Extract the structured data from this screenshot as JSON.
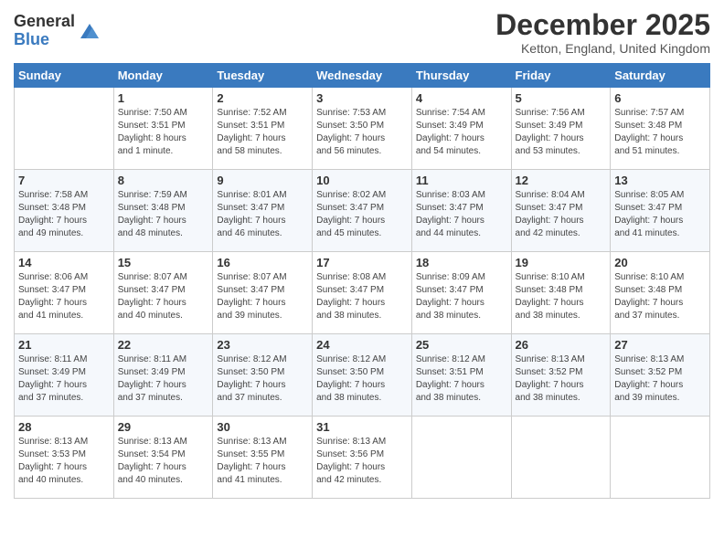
{
  "header": {
    "logo_general": "General",
    "logo_blue": "Blue",
    "month_title": "December 2025",
    "location": "Ketton, England, United Kingdom"
  },
  "days_of_week": [
    "Sunday",
    "Monday",
    "Tuesday",
    "Wednesday",
    "Thursday",
    "Friday",
    "Saturday"
  ],
  "weeks": [
    [
      {
        "day": "",
        "content": ""
      },
      {
        "day": "1",
        "content": "Sunrise: 7:50 AM\nSunset: 3:51 PM\nDaylight: 8 hours\nand 1 minute."
      },
      {
        "day": "2",
        "content": "Sunrise: 7:52 AM\nSunset: 3:51 PM\nDaylight: 7 hours\nand 58 minutes."
      },
      {
        "day": "3",
        "content": "Sunrise: 7:53 AM\nSunset: 3:50 PM\nDaylight: 7 hours\nand 56 minutes."
      },
      {
        "day": "4",
        "content": "Sunrise: 7:54 AM\nSunset: 3:49 PM\nDaylight: 7 hours\nand 54 minutes."
      },
      {
        "day": "5",
        "content": "Sunrise: 7:56 AM\nSunset: 3:49 PM\nDaylight: 7 hours\nand 53 minutes."
      },
      {
        "day": "6",
        "content": "Sunrise: 7:57 AM\nSunset: 3:48 PM\nDaylight: 7 hours\nand 51 minutes."
      }
    ],
    [
      {
        "day": "7",
        "content": "Sunrise: 7:58 AM\nSunset: 3:48 PM\nDaylight: 7 hours\nand 49 minutes."
      },
      {
        "day": "8",
        "content": "Sunrise: 7:59 AM\nSunset: 3:48 PM\nDaylight: 7 hours\nand 48 minutes."
      },
      {
        "day": "9",
        "content": "Sunrise: 8:01 AM\nSunset: 3:47 PM\nDaylight: 7 hours\nand 46 minutes."
      },
      {
        "day": "10",
        "content": "Sunrise: 8:02 AM\nSunset: 3:47 PM\nDaylight: 7 hours\nand 45 minutes."
      },
      {
        "day": "11",
        "content": "Sunrise: 8:03 AM\nSunset: 3:47 PM\nDaylight: 7 hours\nand 44 minutes."
      },
      {
        "day": "12",
        "content": "Sunrise: 8:04 AM\nSunset: 3:47 PM\nDaylight: 7 hours\nand 42 minutes."
      },
      {
        "day": "13",
        "content": "Sunrise: 8:05 AM\nSunset: 3:47 PM\nDaylight: 7 hours\nand 41 minutes."
      }
    ],
    [
      {
        "day": "14",
        "content": "Sunrise: 8:06 AM\nSunset: 3:47 PM\nDaylight: 7 hours\nand 41 minutes."
      },
      {
        "day": "15",
        "content": "Sunrise: 8:07 AM\nSunset: 3:47 PM\nDaylight: 7 hours\nand 40 minutes."
      },
      {
        "day": "16",
        "content": "Sunrise: 8:07 AM\nSunset: 3:47 PM\nDaylight: 7 hours\nand 39 minutes."
      },
      {
        "day": "17",
        "content": "Sunrise: 8:08 AM\nSunset: 3:47 PM\nDaylight: 7 hours\nand 38 minutes."
      },
      {
        "day": "18",
        "content": "Sunrise: 8:09 AM\nSunset: 3:47 PM\nDaylight: 7 hours\nand 38 minutes."
      },
      {
        "day": "19",
        "content": "Sunrise: 8:10 AM\nSunset: 3:48 PM\nDaylight: 7 hours\nand 38 minutes."
      },
      {
        "day": "20",
        "content": "Sunrise: 8:10 AM\nSunset: 3:48 PM\nDaylight: 7 hours\nand 37 minutes."
      }
    ],
    [
      {
        "day": "21",
        "content": "Sunrise: 8:11 AM\nSunset: 3:49 PM\nDaylight: 7 hours\nand 37 minutes."
      },
      {
        "day": "22",
        "content": "Sunrise: 8:11 AM\nSunset: 3:49 PM\nDaylight: 7 hours\nand 37 minutes."
      },
      {
        "day": "23",
        "content": "Sunrise: 8:12 AM\nSunset: 3:50 PM\nDaylight: 7 hours\nand 37 minutes."
      },
      {
        "day": "24",
        "content": "Sunrise: 8:12 AM\nSunset: 3:50 PM\nDaylight: 7 hours\nand 38 minutes."
      },
      {
        "day": "25",
        "content": "Sunrise: 8:12 AM\nSunset: 3:51 PM\nDaylight: 7 hours\nand 38 minutes."
      },
      {
        "day": "26",
        "content": "Sunrise: 8:13 AM\nSunset: 3:52 PM\nDaylight: 7 hours\nand 38 minutes."
      },
      {
        "day": "27",
        "content": "Sunrise: 8:13 AM\nSunset: 3:52 PM\nDaylight: 7 hours\nand 39 minutes."
      }
    ],
    [
      {
        "day": "28",
        "content": "Sunrise: 8:13 AM\nSunset: 3:53 PM\nDaylight: 7 hours\nand 40 minutes."
      },
      {
        "day": "29",
        "content": "Sunrise: 8:13 AM\nSunset: 3:54 PM\nDaylight: 7 hours\nand 40 minutes."
      },
      {
        "day": "30",
        "content": "Sunrise: 8:13 AM\nSunset: 3:55 PM\nDaylight: 7 hours\nand 41 minutes."
      },
      {
        "day": "31",
        "content": "Sunrise: 8:13 AM\nSunset: 3:56 PM\nDaylight: 7 hours\nand 42 minutes."
      },
      {
        "day": "",
        "content": ""
      },
      {
        "day": "",
        "content": ""
      },
      {
        "day": "",
        "content": ""
      }
    ]
  ]
}
